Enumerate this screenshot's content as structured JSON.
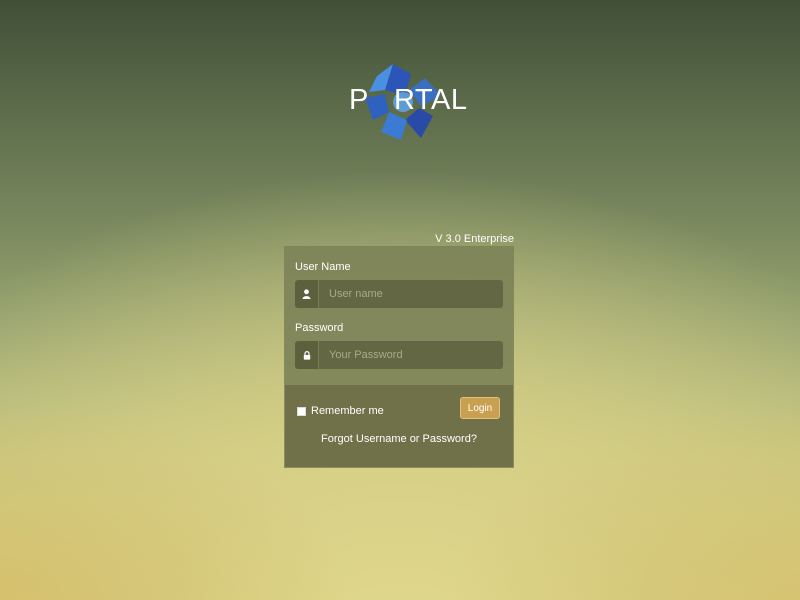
{
  "brand": {
    "letter_p": "P",
    "letters_rtal": "RTAL"
  },
  "version": "V 3.0 Enterprise",
  "form": {
    "username_label": "User Name",
    "username_placeholder": "User name",
    "username_icon": "user-icon",
    "password_label": "Password",
    "password_placeholder": "Your Password",
    "password_icon": "lock-icon",
    "remember_label": "Remember me",
    "login_label": "Login",
    "forgot_link": "Forgot Username or Password?"
  },
  "colors": {
    "accent": "#c9a050",
    "logo_blue": "#3a6fc4"
  }
}
